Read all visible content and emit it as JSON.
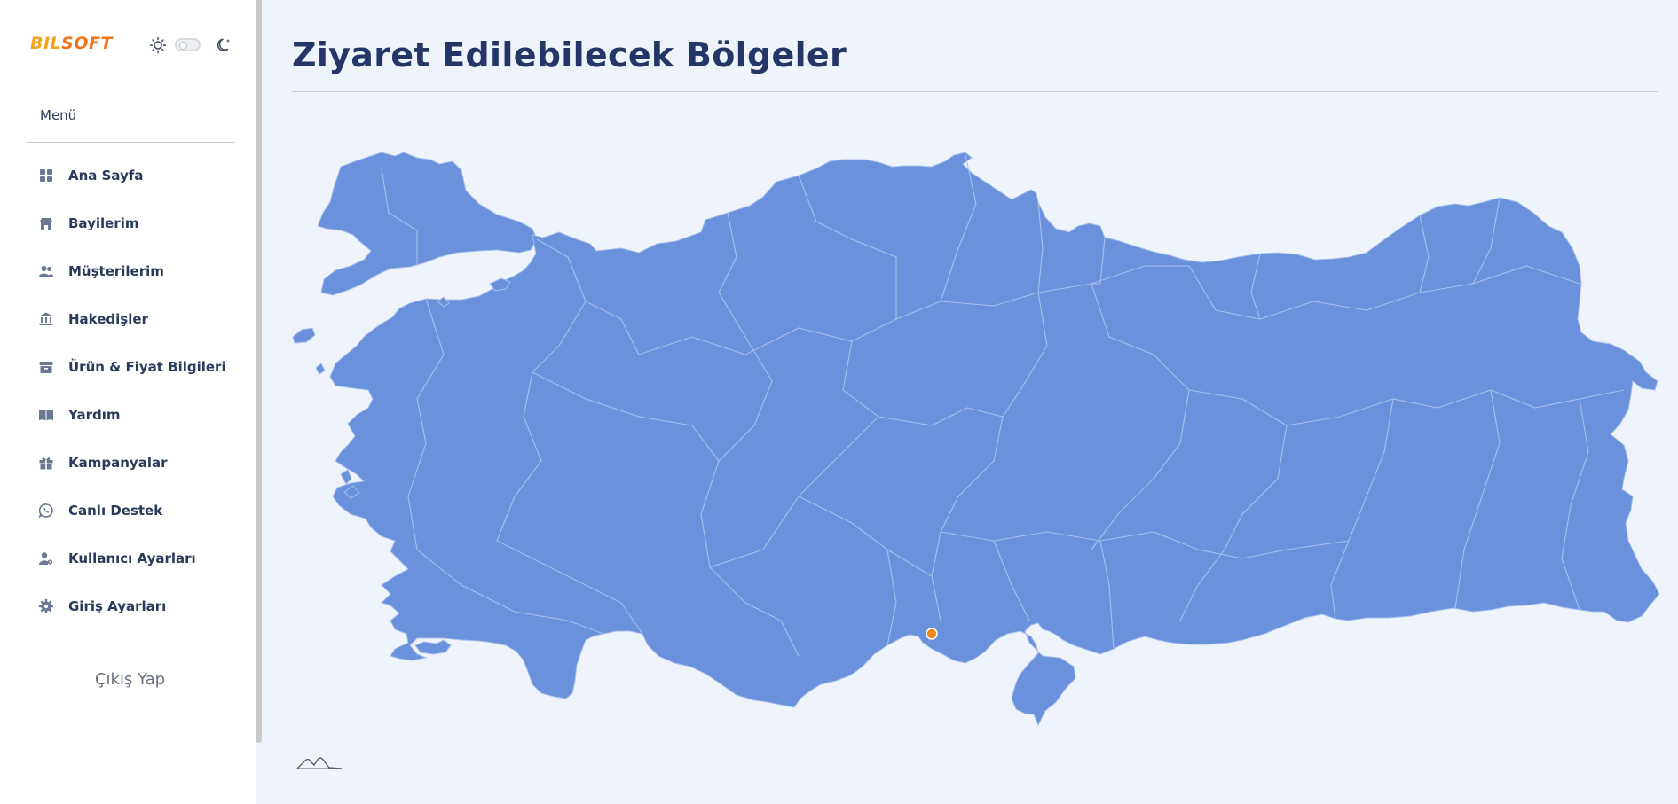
{
  "brand": {
    "part1": "BIL",
    "part2": "SOFT"
  },
  "theme": {
    "light_icon": "sun-icon",
    "dark_icon": "moon-icon",
    "dark_mode": false
  },
  "sidebar": {
    "menu_title": "Menü",
    "items": [
      {
        "label": "Ana Sayfa",
        "icon": "grid-icon"
      },
      {
        "label": "Bayilerim",
        "icon": "store-icon"
      },
      {
        "label": "Müşterilerim",
        "icon": "users-icon"
      },
      {
        "label": "Hakedişler",
        "icon": "bank-icon"
      },
      {
        "label": "Ürün & Fiyat Bilgileri",
        "icon": "box-icon"
      },
      {
        "label": "Yardım",
        "icon": "book-icon"
      },
      {
        "label": "Kampanyalar",
        "icon": "gift-icon"
      },
      {
        "label": "Canlı Destek",
        "icon": "whatsapp-icon"
      },
      {
        "label": "Kullanıcı Ayarları",
        "icon": "user-settings-icon"
      },
      {
        "label": "Giriş Ayarları",
        "icon": "gear-icon"
      }
    ],
    "logout_label": "Çıkış Yap"
  },
  "main": {
    "title": "Ziyaret Edilebilecek Bölgeler"
  },
  "colors": {
    "map_fill": "#6991dc",
    "map_border": "#a9c0ec",
    "marker": "#f5891f",
    "background": "#eff4fc",
    "text_dark": "#243567"
  }
}
